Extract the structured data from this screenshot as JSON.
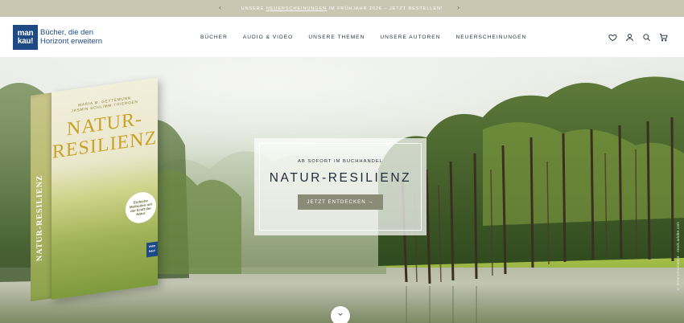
{
  "announcement": {
    "prev_icon": "chevron-left-icon",
    "next_icon": "chevron-right-icon",
    "text_before": "UNSERE ",
    "link_text": "NEUERSCHEINUNGEN",
    "text_after": " IM FRÜHJAHR 2026 – JETZT BESTELLEN!",
    "background": "#c9c6b1"
  },
  "header": {
    "logo_mark_top": "man",
    "logo_mark_bottom": "kau!",
    "logo_tagline_line1": "Bücher, die den",
    "logo_tagline_line2": "Horizont erweitern",
    "brand_color": "#1d4a84",
    "nav": [
      "BÜCHER",
      "AUDIO & VIDEO",
      "UNSERE THEMEN",
      "UNSERE AUTOREN",
      "NEUERSCHEINUNGEN"
    ],
    "icons": [
      "heart-icon",
      "user-icon",
      "search-icon",
      "cart-icon"
    ]
  },
  "hero": {
    "kicker": "AB SOFORT IM BUCHHANDEL",
    "title": "NATUR-RESILIENZ",
    "cta_label": "JETZT ENTDECKEN →",
    "cta_color": "#8a8c78",
    "photo_credit": "© miranomania083 - stock.adobe.com",
    "scroll_icon": "chevron-down-icon"
  },
  "book": {
    "authors_line1": "MARIA M. GETTEMUNN",
    "authors_line2": "JASMIN SCHLIMM-THIERGEN",
    "title_line1": "NATUR-",
    "title_line2": "RESILIENZ",
    "spine_title": "NATUR-RESILIENZ",
    "badge_text": "Einfache Methoden mit der Kraft der Natur",
    "logo_top": "man",
    "logo_bottom": "kau!"
  }
}
